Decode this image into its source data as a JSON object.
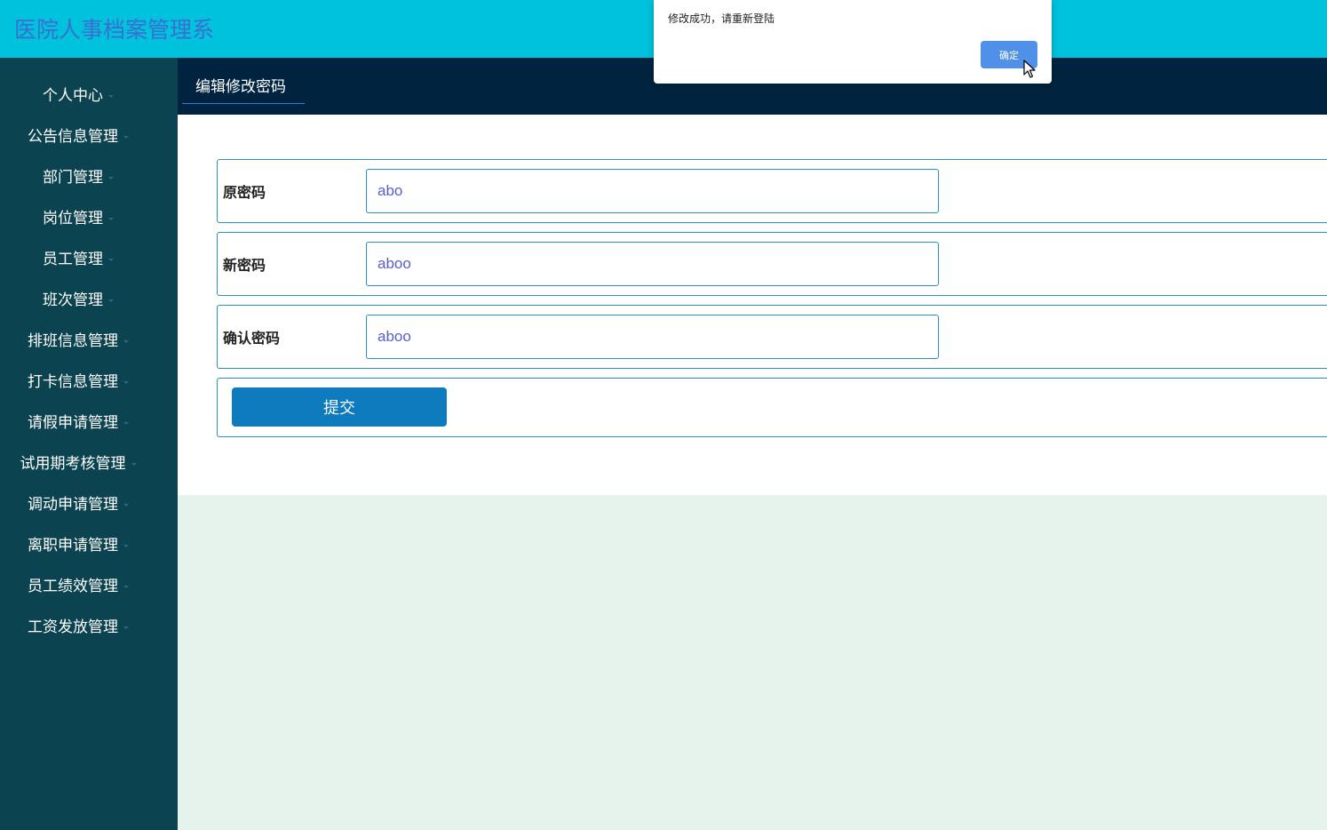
{
  "app": {
    "title": "医院人事档案管理系"
  },
  "sidebar": {
    "items": [
      {
        "label": "个人中心"
      },
      {
        "label": "公告信息管理"
      },
      {
        "label": "部门管理"
      },
      {
        "label": "岗位管理"
      },
      {
        "label": "员工管理"
      },
      {
        "label": "班次管理"
      },
      {
        "label": "排班信息管理"
      },
      {
        "label": "打卡信息管理"
      },
      {
        "label": "请假申请管理"
      },
      {
        "label": "试用期考核管理"
      },
      {
        "label": "调动申请管理"
      },
      {
        "label": "离职申请管理"
      },
      {
        "label": "员工绩效管理"
      },
      {
        "label": "工资发放管理"
      }
    ]
  },
  "tabs": {
    "active": "编辑修改密码"
  },
  "form": {
    "old_password": {
      "label": "原密码",
      "value": "abo"
    },
    "new_password": {
      "label": "新密码",
      "value": "aboo"
    },
    "confirm_password": {
      "label": "确认密码",
      "value": "aboo"
    },
    "submit_label": "提交"
  },
  "dialog": {
    "message": "修改成功，请重新登陆",
    "ok_label": "确定"
  },
  "colors": {
    "header": "#00c2dd",
    "sidebar": "#0b4350",
    "tabbar": "#002440",
    "primary": "#0f7bbf"
  }
}
